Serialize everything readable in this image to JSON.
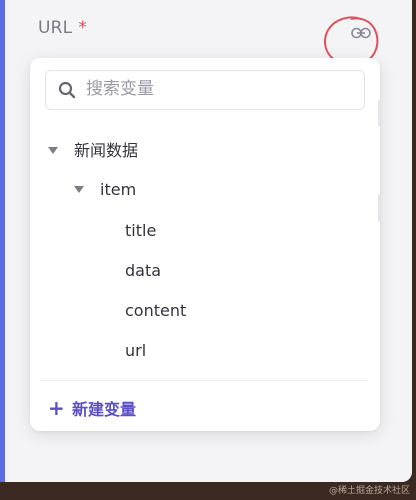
{
  "field": {
    "label": "URL",
    "required_mark": "*"
  },
  "search": {
    "placeholder": "搜索变量",
    "value": ""
  },
  "tree": {
    "root": {
      "label": "新闻数据"
    },
    "item": {
      "label": "item"
    },
    "leaves": [
      {
        "label": "title"
      },
      {
        "label": "data"
      },
      {
        "label": "content"
      },
      {
        "label": "url"
      }
    ]
  },
  "footer": {
    "new_variable_label": "新建变量"
  },
  "colors": {
    "accent": "#5b6ee1",
    "required": "#e5484d",
    "link_action": "#5b4fc4",
    "annotation": "#e0505a"
  },
  "icons": {
    "link": "link-icon",
    "search": "search-icon",
    "caret": "caret-down-icon",
    "plus": "plus-icon"
  },
  "watermark": "@稀土掘金技术社区"
}
